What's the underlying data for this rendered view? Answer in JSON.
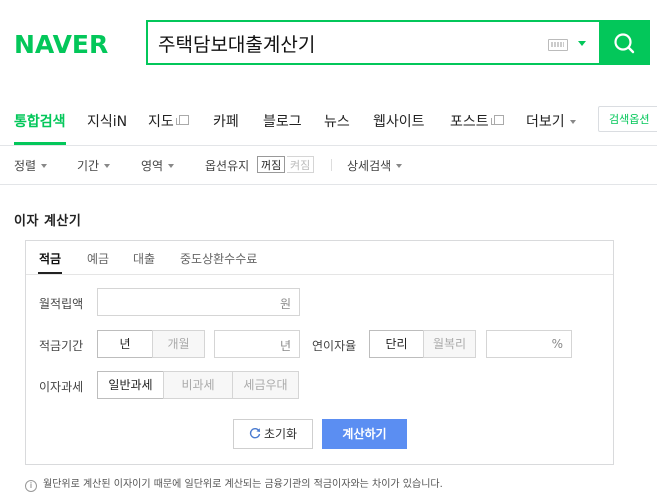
{
  "logo": "NAVER",
  "search": {
    "query": "주택담보대출계산기"
  },
  "tabs": [
    {
      "label": "통합검색",
      "active": true
    },
    {
      "label": "지식iN"
    },
    {
      "label": "지도"
    },
    {
      "label": "카페"
    },
    {
      "label": "블로그"
    },
    {
      "label": "뉴스"
    },
    {
      "label": "웹사이트"
    },
    {
      "label": "포스트"
    },
    {
      "label": "더보기"
    }
  ],
  "search_options": "검색옵션",
  "filters": {
    "sort": "정렬",
    "period": "기간",
    "area": "영역",
    "keep_label": "옵션유지",
    "on": "꺼짐",
    "off": "켜짐",
    "detail": "상세검색"
  },
  "calculator": {
    "title": "이자 계산기",
    "tabs": [
      "적금",
      "예금",
      "대출",
      "중도상환수수료"
    ],
    "monthly_label": "월적립액",
    "monthly_unit": "원",
    "period_label": "적금기간",
    "period_year": "년",
    "period_month": "개월",
    "period_unit": "년",
    "rate_label": "연이자율",
    "rate_simple": "단리",
    "rate_compound": "월복리",
    "rate_unit": "%",
    "tax_label": "이자과세",
    "tax_options": [
      "일반과세",
      "비과세",
      "세금우대"
    ],
    "reset": "초기화",
    "calculate": "계산하기",
    "note": "월단위로 계산된 이자이기 때문에 일단위로 계산되는 금융기관의 적금이자와는 차이가 있습니다."
  },
  "colors": {
    "brand": "#03c75a",
    "calc_button": "#5b8ef2"
  }
}
